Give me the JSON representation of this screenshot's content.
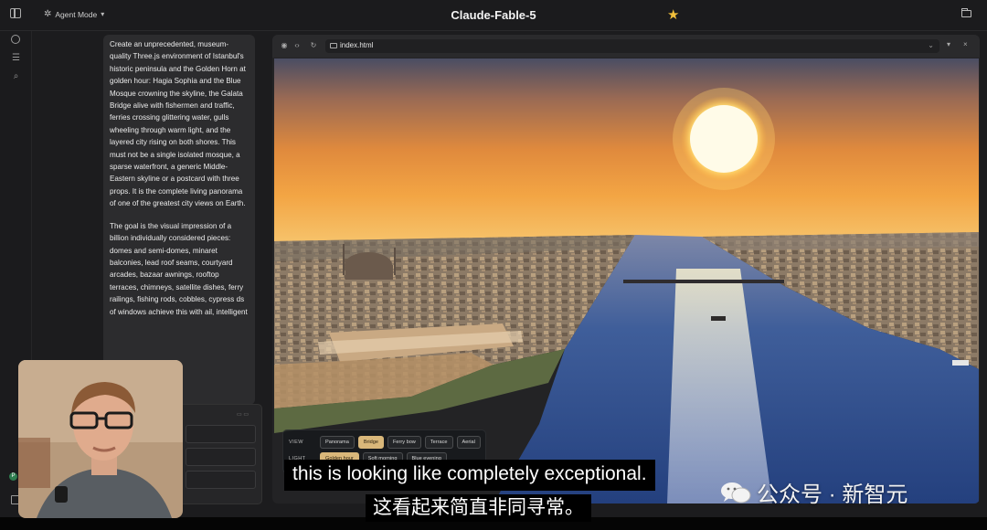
{
  "titlebar": {
    "mode_label": "Agent Mode",
    "title": "Claude-Fable-5"
  },
  "chat": {
    "prompt_paragraph_1": "Create an unprecedented, museum-quality Three.js environment of Istanbul's historic peninsula and the Golden Horn at golden hour: Hagia Sophia and the Blue Mosque crowning the skyline, the Galata Bridge alive with fishermen and traffic, ferries crossing glittering water, gulls wheeling through warm light, and the layered city rising on both shores. This must not be a single isolated mosque, a sparse waterfront, a generic Middle-Eastern skyline or a postcard with three props. It is the complete living panorama of one of the greatest city views on Earth.",
    "prompt_paragraph_2": "The goal is the visual impression of a billion individually considered pieces: domes and semi-domes, minaret balconies, lead roof seams, courtyard arcades, bazaar awnings, rooftop terraces, chimneys, satellite dishes, ferry railings, fishing rods,",
    "prompt_paragraph_2_occluded_1": "cobbles, cypress",
    "prompt_paragraph_2_occluded_2": "ds of windows",
    "prompt_paragraph_2_occluded_3": "achieve this with",
    "prompt_paragraph_2_occluded_4": "ail, intelligent"
  },
  "preview": {
    "url": "index.html",
    "controls": {
      "view_label": "VIEW",
      "view_options": [
        "Panorama",
        "Bridge",
        "Ferry bow",
        "Terrace",
        "Aerial"
      ],
      "view_selected": "Bridge",
      "light_label": "LIGHT",
      "light_options": [
        "Golden hour",
        "Soft morning",
        "Blue evening"
      ],
      "light_selected": "Golden hour"
    }
  },
  "subtitles": {
    "english": "this is looking like completely exceptional.",
    "chinese": "这看起来简直非同寻常。"
  },
  "watermark": {
    "text": "公众号 · 新智元"
  },
  "colors": {
    "accent_star": "#f1bf3b",
    "active_button": "#d9b77a",
    "avatar_badge": "#2e7d4f"
  }
}
